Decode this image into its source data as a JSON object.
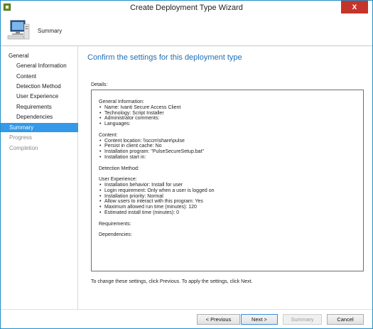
{
  "window": {
    "title": "Create Deployment Type Wizard",
    "close_glyph": "x"
  },
  "header": {
    "title": "Summary",
    "icon": "computer-icon"
  },
  "nav": {
    "items": [
      {
        "label": "General",
        "level": "top",
        "state": "normal"
      },
      {
        "label": "General Information",
        "level": "sub",
        "state": "normal"
      },
      {
        "label": "Content",
        "level": "sub",
        "state": "normal"
      },
      {
        "label": "Detection Method",
        "level": "sub",
        "state": "normal"
      },
      {
        "label": "User Experience",
        "level": "sub",
        "state": "normal"
      },
      {
        "label": "Requirements",
        "level": "sub",
        "state": "normal"
      },
      {
        "label": "Dependencies",
        "level": "sub",
        "state": "normal"
      },
      {
        "label": "Summary",
        "level": "top",
        "state": "active"
      },
      {
        "label": "Progress",
        "level": "top",
        "state": "disabled"
      },
      {
        "label": "Completion",
        "level": "top",
        "state": "disabled"
      }
    ]
  },
  "main": {
    "heading": "Confirm the settings for this deployment type",
    "details_label": "Details:",
    "details": [
      {
        "text": "General Information:",
        "bullet": false
      },
      {
        "text": "Name: Ivanti Secure Access Client",
        "bullet": true
      },
      {
        "text": "Technology: Script Installer",
        "bullet": true
      },
      {
        "text": "Administrator comments:",
        "bullet": true
      },
      {
        "text": "Languages:",
        "bullet": true
      },
      {
        "text": "",
        "bullet": false
      },
      {
        "text": "Content:",
        "bullet": false
      },
      {
        "text": "Content location: \\\\sccm\\share\\pulse",
        "bullet": true
      },
      {
        "text": "Persist in client cache: No",
        "bullet": true
      },
      {
        "text": "Installation program: \"PulseSecureSetup.bat\"",
        "bullet": true
      },
      {
        "text": "Installation start in:",
        "bullet": true
      },
      {
        "text": "",
        "bullet": false
      },
      {
        "text": "Detection Method:",
        "bullet": false
      },
      {
        "text": "",
        "bullet": false
      },
      {
        "text": "User Experience:",
        "bullet": false
      },
      {
        "text": "Installation behavior: Install for user",
        "bullet": true
      },
      {
        "text": "Login requirement: Only when a user is logged on",
        "bullet": true
      },
      {
        "text": "Installation priority: Normal",
        "bullet": true
      },
      {
        "text": "Allow users to interact with this program: Yes",
        "bullet": true
      },
      {
        "text": "Maximum allowed run time (minutes): 120",
        "bullet": true
      },
      {
        "text": "Estimated install time (minutes): 0",
        "bullet": true
      },
      {
        "text": "",
        "bullet": false
      },
      {
        "text": "Requirements:",
        "bullet": false
      },
      {
        "text": "",
        "bullet": false
      },
      {
        "text": "Dependencies:",
        "bullet": false
      }
    ],
    "hint": "To change these settings, click Previous. To apply the settings, click Next."
  },
  "footer": {
    "previous_label": "< Previous",
    "next_label": "Next >",
    "summary_label": "Summary",
    "cancel_label": "Cancel"
  }
}
